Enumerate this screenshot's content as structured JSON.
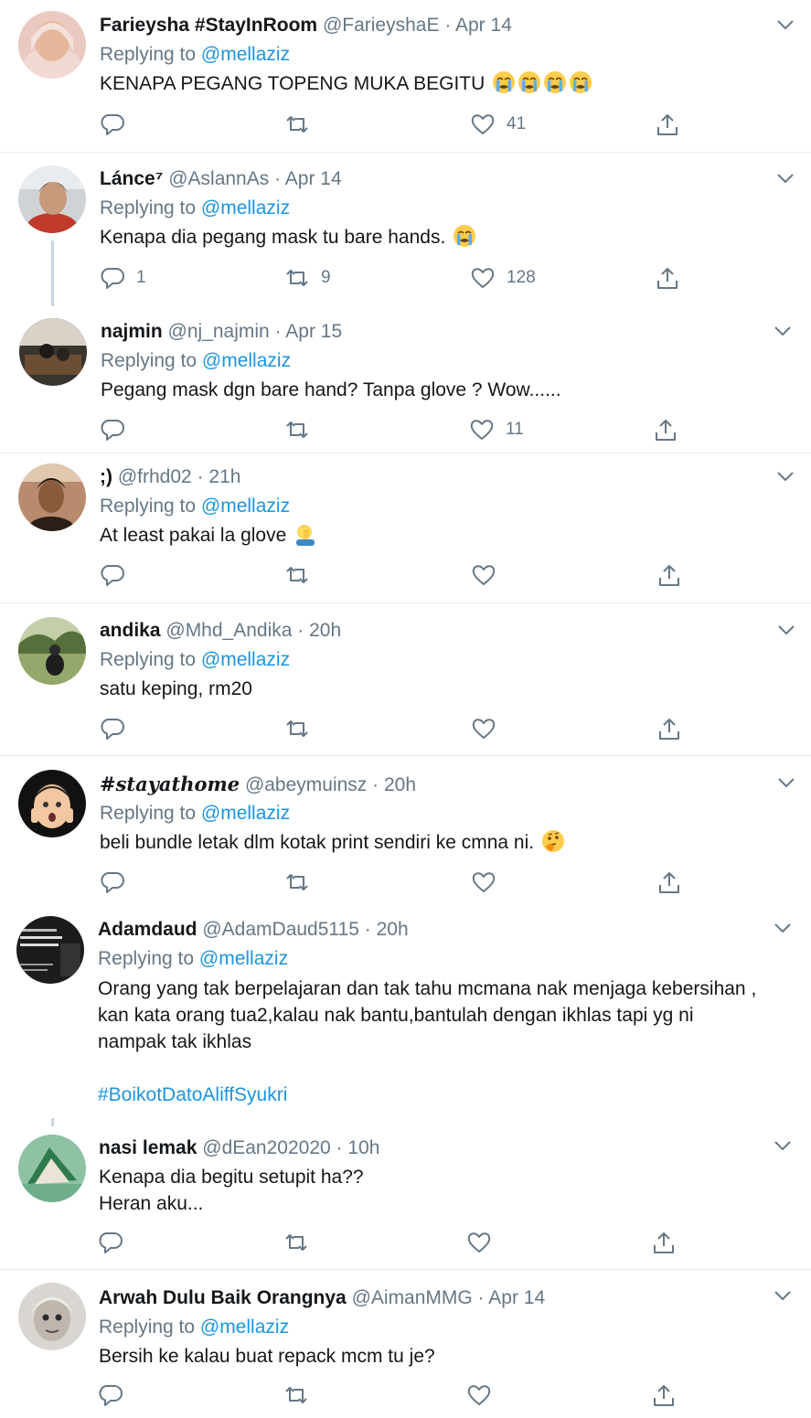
{
  "reply_prefix": "Replying to",
  "tweets": [
    {
      "name": "Farieysha #StayInRoom",
      "handle": "@FarieyshaE",
      "time": "Apr 14",
      "reply_to": "@mellaziz",
      "text": "KENAPA PEGANG TOPENG MUKA BEGITU",
      "emoji": "crying-face x4",
      "replies": "",
      "retweets": "",
      "likes": "41"
    },
    {
      "name": "Lánce⁷",
      "handle": "@AslannAs",
      "time": "Apr 14",
      "reply_to": "@mellaziz",
      "text": "Kenapa dia pegang mask tu bare hands.",
      "emoji": "crying-face",
      "replies": "1",
      "retweets": "9",
      "likes": "128"
    },
    {
      "name": "najmin",
      "handle": "@nj_najmin",
      "time": "Apr 15",
      "reply_to": "@mellaziz",
      "text": "Pegang mask dgn bare hand? Tanpa glove ? Wow......",
      "replies": "",
      "retweets": "",
      "likes": "11"
    },
    {
      "name": ";)",
      "handle": "@frhd02",
      "time": "21h",
      "reply_to": "@mellaziz",
      "text": "At least pakai la glove",
      "emoji": "facepalm",
      "replies": "",
      "retweets": "",
      "likes": ""
    },
    {
      "name": "andika",
      "handle": "@Mhd_Andika",
      "time": "20h",
      "reply_to": "@mellaziz",
      "text": "satu keping, rm20",
      "replies": "",
      "retweets": "",
      "likes": ""
    },
    {
      "name": "#𝒔𝒕𝒂𝒚𝒂𝒕𝒉𝒐𝒎𝒆",
      "handle": "@abeymuinsz",
      "time": "20h",
      "reply_to": "@mellaziz",
      "text": "beli bundle letak dlm kotak print sendiri ke cmna ni.",
      "emoji": "thinking-face",
      "replies": "",
      "retweets": "",
      "likes": ""
    },
    {
      "name": "Adamdaud",
      "handle": "@AdamDaud5115",
      "time": "20h",
      "reply_to": "@mellaziz",
      "lines": [
        "Orang yang tak berpelajaran dan tak tahu mcmana nak menjaga kebersihan ,",
        "kan kata orang tua2,kalau nak bantu,bantulah dengan ikhlas tapi yg ni",
        "nampak tak ikhlas"
      ],
      "hashtag": "#BoikotDatoAliffSyukri"
    },
    {
      "name": "nasi lemak",
      "handle": "@dEan202020",
      "time": "10h",
      "lines": [
        "Kenapa dia begitu setupit ha??",
        "Heran aku..."
      ],
      "replies": "",
      "retweets": "",
      "likes": ""
    },
    {
      "name": "Arwah Dulu Baik Orangnya",
      "handle": "@AimanMMG",
      "time": "Apr 14",
      "reply_to": "@mellaziz",
      "text": "Bersih ke kalau buat repack mcm tu je?",
      "replies": "",
      "retweets": "",
      "likes": ""
    }
  ],
  "colors": {
    "accent": "#1b95e0",
    "secondary": "#657786",
    "border": "#e6ecf0"
  }
}
